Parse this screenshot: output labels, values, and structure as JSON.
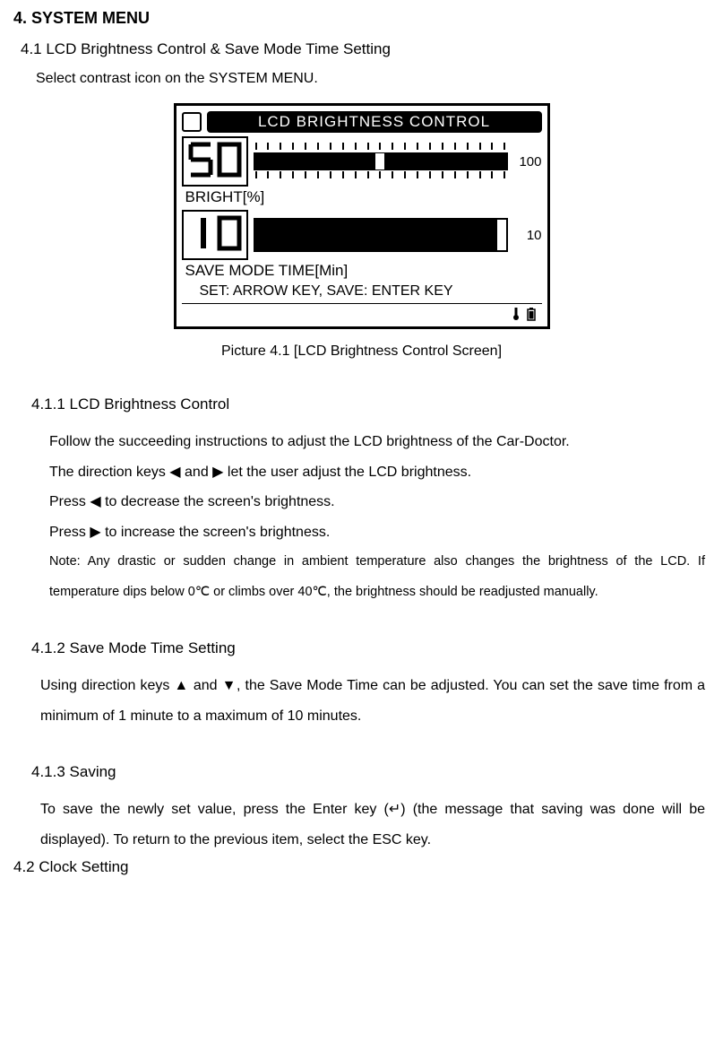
{
  "headings": {
    "h2": "4. SYSTEM MENU",
    "h3_1": "4.1 LCD Brightness Control & Save Mode Time Setting",
    "intro": "Select contrast icon on the SYSTEM MENU.",
    "caption": "Picture 4.1 [LCD Brightness Control Screen]",
    "h4_1": "4.1.1 LCD Brightness Control",
    "h4_2": "4.1.2 Save Mode Time Setting",
    "h4_3": "4.1.3 Saving",
    "h3_2": "4.2 Clock Setting"
  },
  "lcd": {
    "title": "LCD BRIGHTNESS CONTROL",
    "bright_value": "50",
    "bright_max": "100",
    "bright_label": "BRIGHT[%]",
    "save_value": "10",
    "save_max": "10",
    "save_label": "SAVE MODE TIME[Min]",
    "footer": "SET: ARROW KEY, SAVE: ENTER KEY"
  },
  "section_411": {
    "p1": "Follow the succeeding instructions to adjust the LCD brightness of the Car-Doctor.",
    "p2": "The direction keys ◀ and ▶ let the user adjust the LCD brightness.",
    "p3": "Press ◀ to decrease the screen's brightness.",
    "p4": "Press ▶ to increase the screen's brightness.",
    "note": "Note: Any drastic or sudden change in ambient temperature also changes the brightness of the LCD. If temperature dips below 0℃ or climbs over 40℃, the brightness should be readjusted manually."
  },
  "section_412": {
    "p1": "Using direction keys ▲ and ▼, the Save Mode Time can be adjusted. You can set the save time from a minimum of 1 minute to a maximum of 10 minutes."
  },
  "section_413": {
    "p1": "To save the newly set value, press the Enter key (↵) (the message that saving was done will be displayed). To return to the previous item, select the ESC key."
  }
}
